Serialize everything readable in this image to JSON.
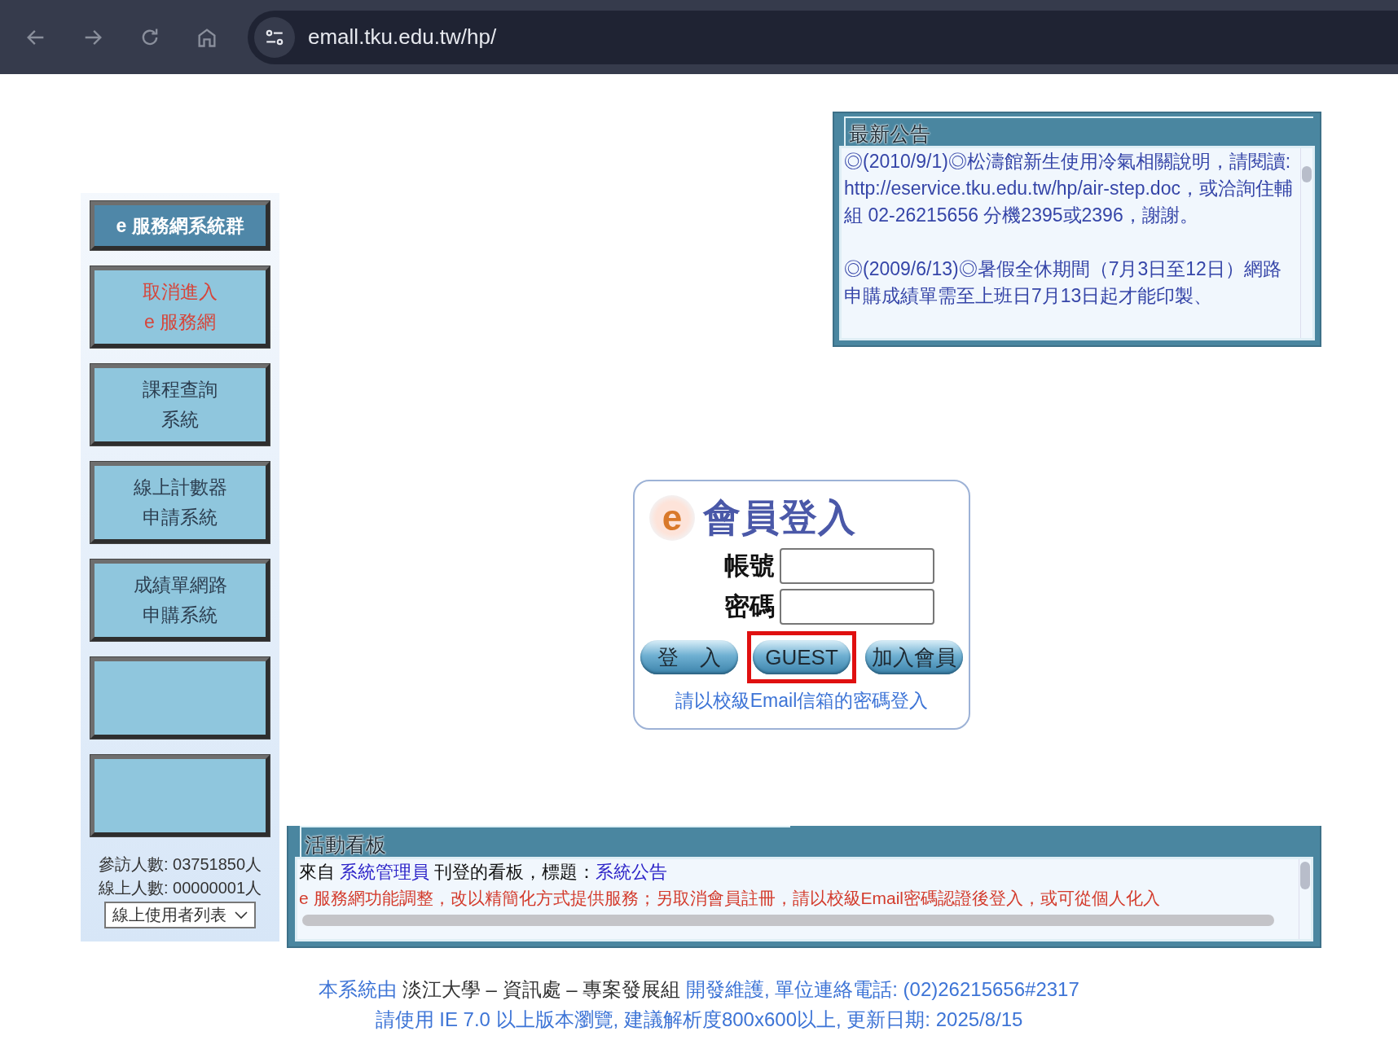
{
  "browser": {
    "url": "emall.tku.edu.tw/hp/"
  },
  "sidebar": {
    "items": [
      {
        "kind": "header",
        "label": "e 服務網系統群"
      },
      {
        "kind": "cancel",
        "lines": [
          "取消進入",
          "e 服務網"
        ]
      },
      {
        "kind": "link",
        "lines": [
          "課程查詢",
          "系統"
        ]
      },
      {
        "kind": "link",
        "lines": [
          "線上計數器",
          "申請系統"
        ]
      },
      {
        "kind": "link",
        "lines": [
          "成績單網路",
          "申購系統"
        ]
      },
      {
        "kind": "blank"
      },
      {
        "kind": "blank"
      }
    ],
    "visitors": "參訪人數: 03751850人",
    "online": "線上人數: 00000001人",
    "online_users_select": "線上使用者列表"
  },
  "announcements": {
    "title": "最新公告",
    "items": [
      "◎(2010/9/1)◎松濤館新生使用冷氣相關說明，請閱讀: http://eservice.tku.edu.tw/hp/air-step.doc，或洽詢住輔組 02-26215656 分機2395或2396，謝謝。",
      "◎(2009/6/13)◎暑假全休期間（7月3日至12日）網路申購成績單需至上班日7月13日起才能印製、"
    ]
  },
  "login": {
    "logo_letter": "e",
    "title": "會員登入",
    "fields": [
      {
        "label": "帳號"
      },
      {
        "label": "密碼"
      }
    ],
    "buttons": [
      {
        "label": "登　入",
        "highlighted": false
      },
      {
        "label": "GUEST",
        "highlighted": true
      },
      {
        "label": "加入會員",
        "highlighted": false
      }
    ],
    "hint": "請以校級Email信箱的密碼登入"
  },
  "board": {
    "title": "活動看板",
    "header": [
      {
        "kind": "plain",
        "text": "來自 "
      },
      {
        "kind": "link",
        "text": "系統管理員"
      },
      {
        "kind": "plain",
        "text": " 刊登的看板，標題："
      },
      {
        "kind": "link",
        "text": "系統公告"
      }
    ],
    "message": "e 服務網功能調整，改以精簡化方式提供服務；另取消會員註冊，請以校級Email密碼認證後登入，或可從個人化入"
  },
  "footer": {
    "lines": [
      [
        {
          "kind": "blue",
          "text": "本系統由 "
        },
        {
          "kind": "dark",
          "text": "淡江大學 – 資訊處 – 專案發展組"
        },
        {
          "kind": "blue",
          "text": " 開發維護, 單位連絡電話: (02)26215656#2317"
        }
      ],
      [
        {
          "kind": "blue",
          "text": "請使用 IE 7.0 以上版本瀏覽, 建議解析度800x600以上, 更新日期: 2025/8/15"
        }
      ]
    ]
  }
}
